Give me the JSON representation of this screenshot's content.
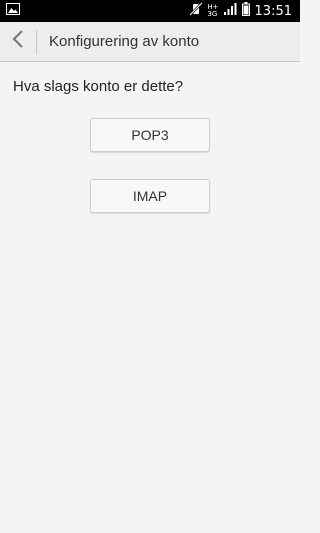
{
  "status_bar": {
    "time": "13:51",
    "network_top": "H+",
    "network_bottom": "3G",
    "icons": [
      "image-notification-icon",
      "vibrate-off-icon",
      "signal-icon",
      "battery-icon"
    ]
  },
  "header": {
    "title": "Konfigurering av konto"
  },
  "main": {
    "question": "Hva slags konto er dette?",
    "options": [
      "POP3",
      "IMAP"
    ]
  }
}
